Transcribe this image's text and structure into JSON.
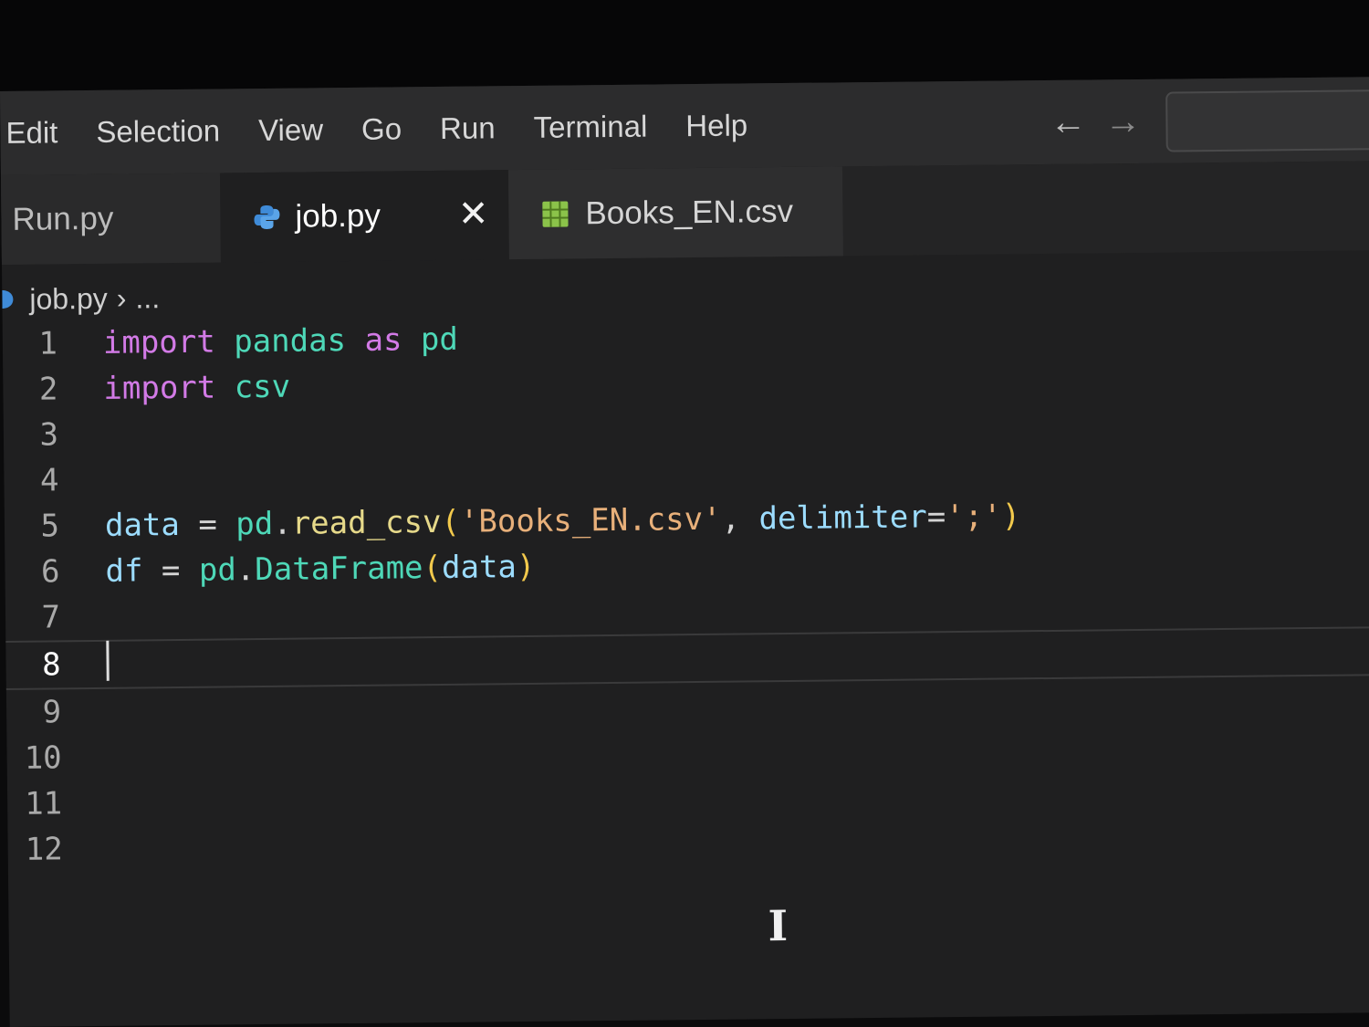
{
  "menu": [
    "Edit",
    "Selection",
    "View",
    "Go",
    "Run",
    "Terminal",
    "Help"
  ],
  "nav": {
    "back": "←",
    "forward": "→"
  },
  "tabs": [
    {
      "label": "Run.py"
    },
    {
      "label": "job.py",
      "close": "✕"
    },
    {
      "label": "Books_EN.csv"
    }
  ],
  "breadcrumb": {
    "file": "job.py",
    "sep": "›",
    "more": "..."
  },
  "editor": {
    "lines": [
      {
        "num": "1",
        "tokens": [
          {
            "t": "import",
            "c": "kw"
          },
          {
            "t": " ",
            "c": "op"
          },
          {
            "t": "pandas",
            "c": "mod"
          },
          {
            "t": " ",
            "c": "op"
          },
          {
            "t": "as",
            "c": "kw"
          },
          {
            "t": " ",
            "c": "op"
          },
          {
            "t": "pd",
            "c": "mod"
          }
        ]
      },
      {
        "num": "2",
        "tokens": [
          {
            "t": "import",
            "c": "kw"
          },
          {
            "t": " ",
            "c": "op"
          },
          {
            "t": "csv",
            "c": "mod"
          }
        ]
      },
      {
        "num": "3",
        "tokens": []
      },
      {
        "num": "4",
        "tokens": []
      },
      {
        "num": "5",
        "tokens": [
          {
            "t": "data",
            "c": "var"
          },
          {
            "t": " = ",
            "c": "op"
          },
          {
            "t": "pd",
            "c": "mod"
          },
          {
            "t": ".",
            "c": "op"
          },
          {
            "t": "read_csv",
            "c": "fn"
          },
          {
            "t": "(",
            "c": "paren"
          },
          {
            "t": "'Books_EN.csv'",
            "c": "str"
          },
          {
            "t": ", ",
            "c": "op"
          },
          {
            "t": "delimiter",
            "c": "var"
          },
          {
            "t": "=",
            "c": "op"
          },
          {
            "t": "';'",
            "c": "str"
          },
          {
            "t": ")",
            "c": "paren"
          }
        ]
      },
      {
        "num": "6",
        "tokens": [
          {
            "t": "df",
            "c": "var"
          },
          {
            "t": " = ",
            "c": "op"
          },
          {
            "t": "pd",
            "c": "mod"
          },
          {
            "t": ".",
            "c": "op"
          },
          {
            "t": "DataFrame",
            "c": "mod"
          },
          {
            "t": "(",
            "c": "paren"
          },
          {
            "t": "data",
            "c": "var"
          },
          {
            "t": ")",
            "c": "paren"
          }
        ]
      },
      {
        "num": "7",
        "tokens": []
      },
      {
        "num": "8",
        "tokens": [],
        "current": true
      },
      {
        "num": "9",
        "tokens": []
      },
      {
        "num": "10",
        "tokens": []
      },
      {
        "num": "11",
        "tokens": []
      },
      {
        "num": "12",
        "tokens": []
      }
    ]
  },
  "icons": {
    "python": "python-icon",
    "csv": "csv-table-icon",
    "close": "close-icon",
    "cursor": "text-ibeam-cursor-icon"
  },
  "colors": {
    "keyword": "#d27ae6",
    "module": "#4ed8b8",
    "variable": "#9cdcfe",
    "function": "#e6d98a",
    "string": "#e8b07a",
    "bracket": "#f2c94c"
  }
}
